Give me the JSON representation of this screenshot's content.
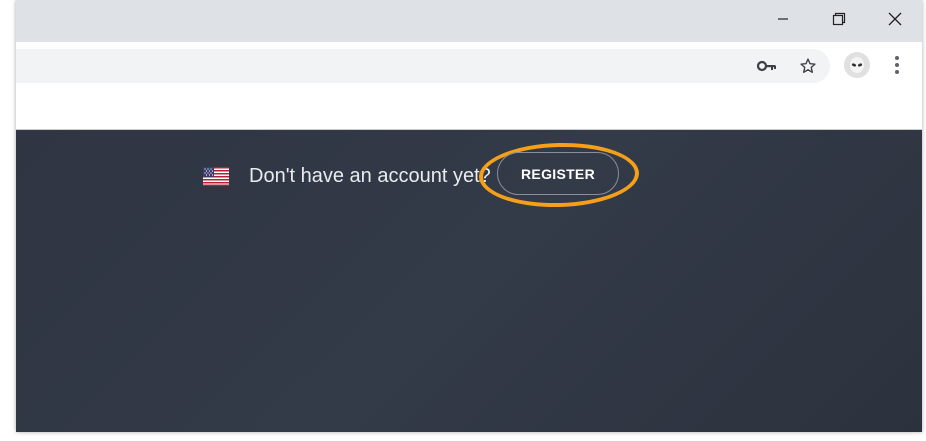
{
  "browser": {
    "window_controls": {
      "minimize_icon": "minimize-icon",
      "restore_icon": "restore-icon",
      "close_icon": "close-icon"
    },
    "toolbar": {
      "key_icon": "key-icon",
      "star_icon": "star-icon",
      "avatar_icon": "alien-avatar-icon",
      "menu_icon": "more-vertical-icon"
    }
  },
  "page": {
    "prompt_text": "Don't have an account yet?",
    "register_label": "REGISTER",
    "flag_icon": "us-flag-icon",
    "highlight_color": "#f6a01a",
    "background_color": "#2f3542"
  }
}
